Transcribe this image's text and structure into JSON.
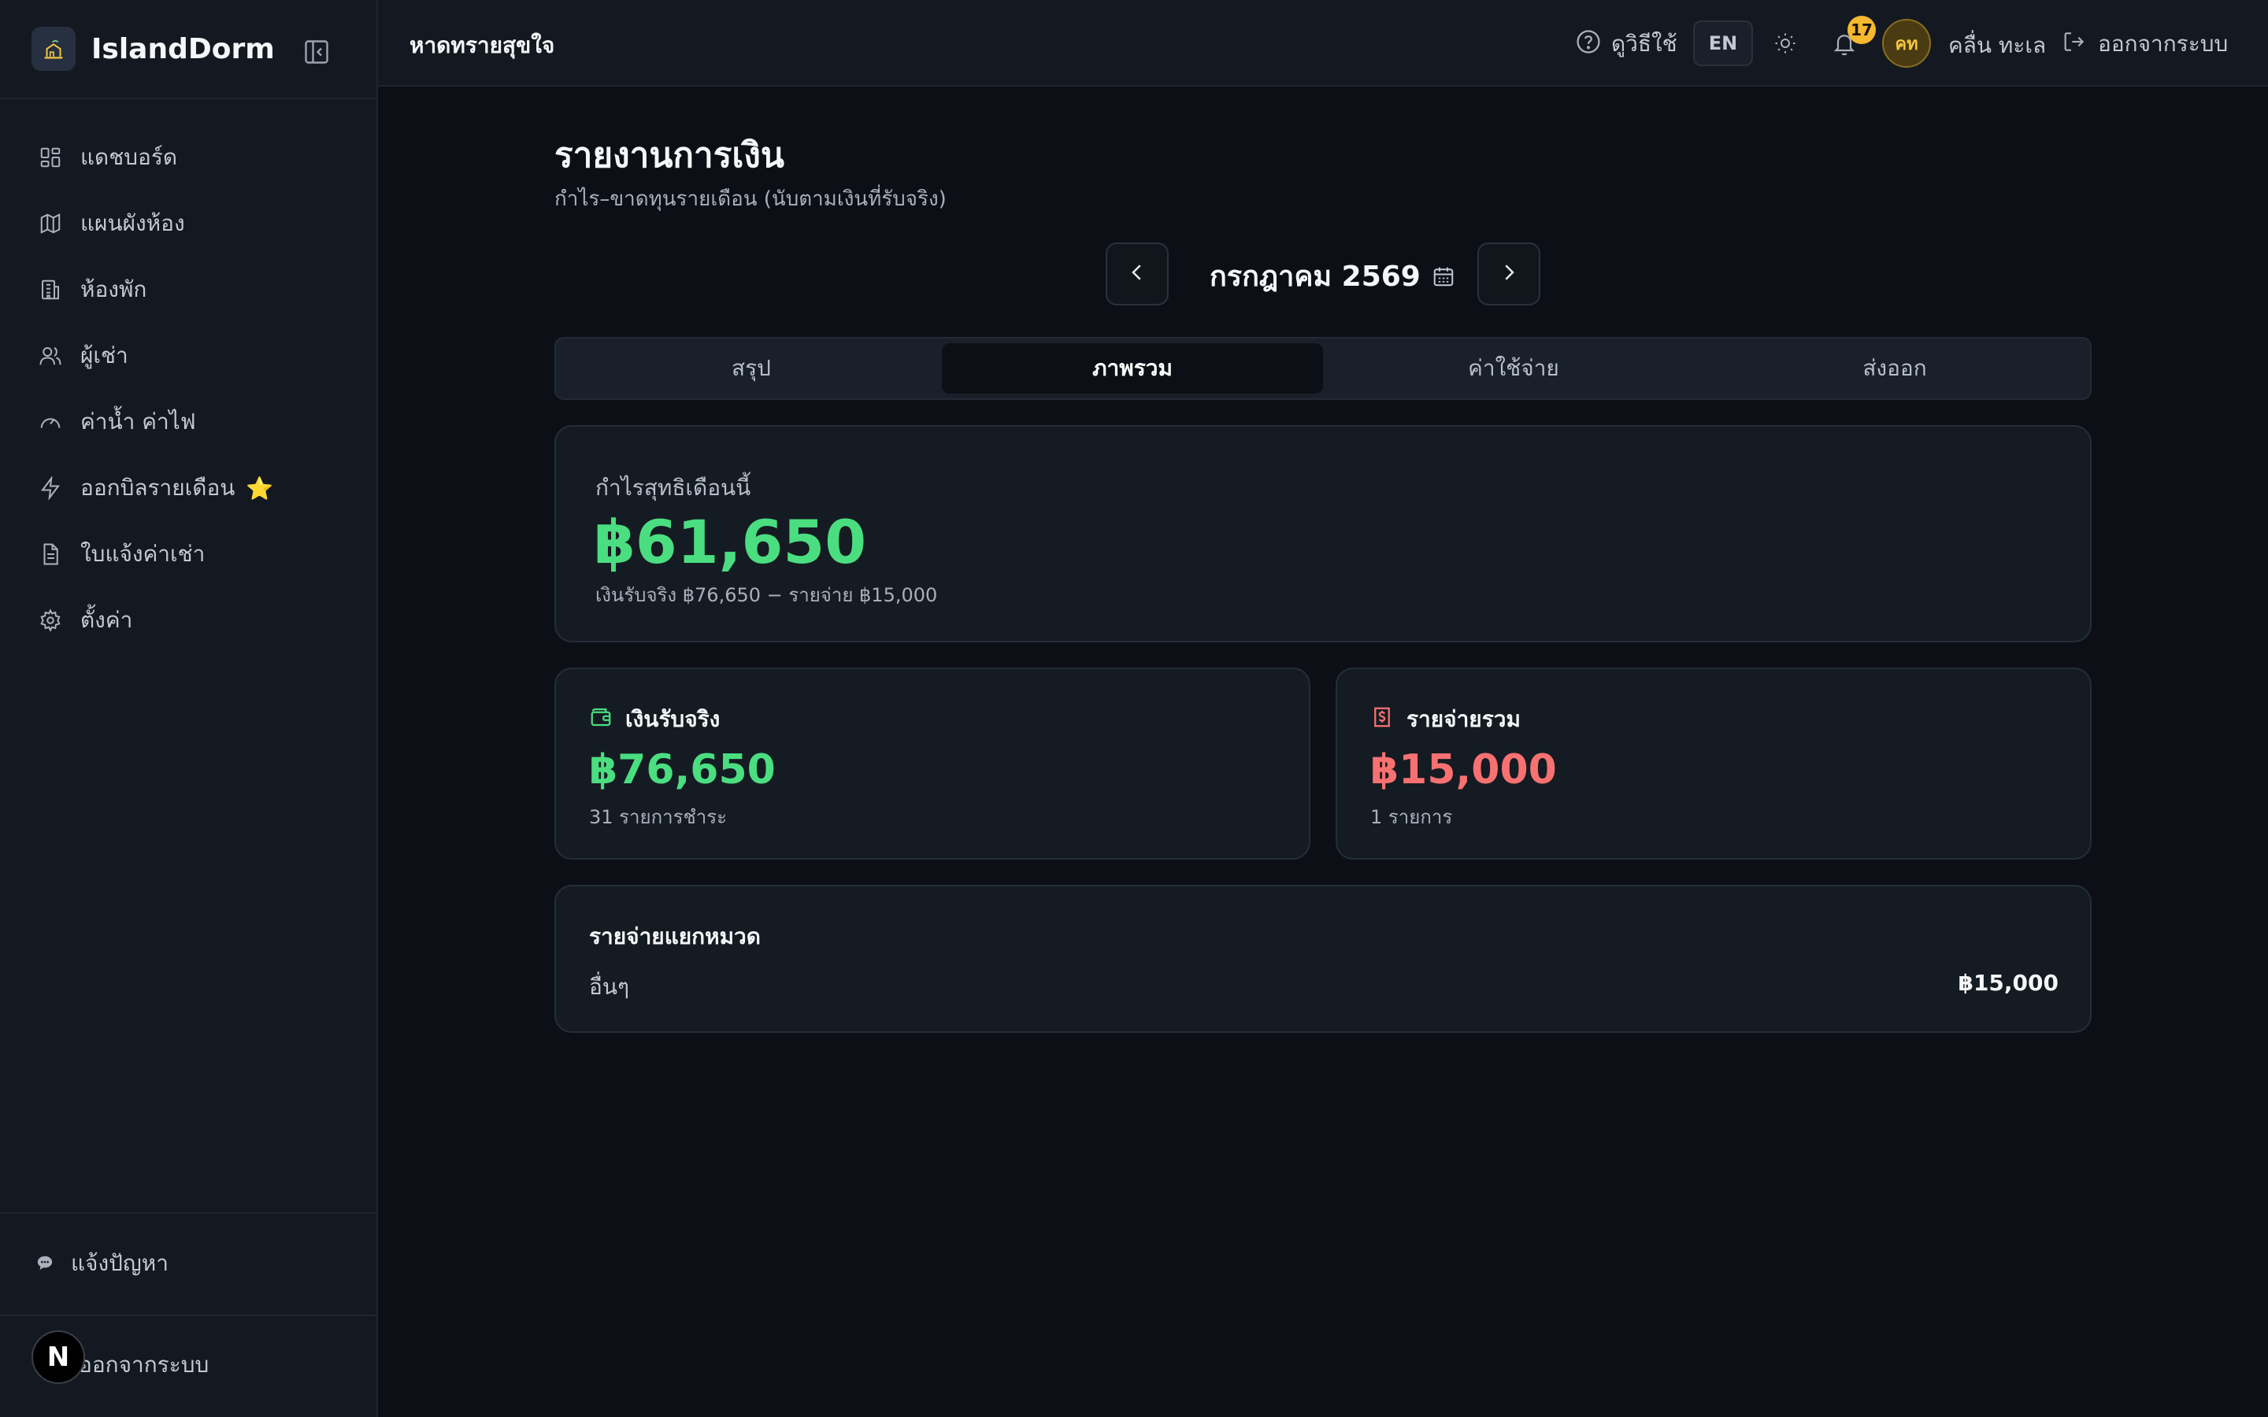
{
  "app": {
    "name": "IslandDorm"
  },
  "sidebar": {
    "items": [
      {
        "label": "แดชบอร์ด",
        "icon": "dashboard-icon"
      },
      {
        "label": "แผนผังห้อง",
        "icon": "map-icon"
      },
      {
        "label": "ห้องพัก",
        "icon": "building-icon"
      },
      {
        "label": "ผู้เช่า",
        "icon": "users-icon"
      },
      {
        "label": "ค่าน้ำ ค่าไฟ",
        "icon": "gauge-icon"
      },
      {
        "label": "ออกบิลรายเดือน",
        "icon": "lightning-icon",
        "badge": "⭐"
      },
      {
        "label": "ใบแจ้งค่าเช่า",
        "icon": "document-icon"
      },
      {
        "label": "ตั้งค่า",
        "icon": "gear-icon"
      }
    ],
    "report_issue": "แจ้งปัญหา",
    "logout": "ออกจากระบบ",
    "dev_badge": "N"
  },
  "topbar": {
    "dorm_name": "หาดทรายสุขใจ",
    "help": "ดูวิธีใช้",
    "lang": "EN",
    "notifications_count": "17",
    "avatar_initials": "คท",
    "user_name": "คลื่น ทะเล",
    "logout": "ออกจากระบบ"
  },
  "page": {
    "title": "รายงานการเงิน",
    "subtitle": "กำไร–ขาดทุนรายเดือน (นับตามเงินที่รับจริง)",
    "month": "กรกฎาคม 2569"
  },
  "tabs": [
    {
      "label": "สรุป",
      "active": false
    },
    {
      "label": "ภาพรวม",
      "active": true
    },
    {
      "label": "ค่าใช้จ่าย",
      "active": false
    },
    {
      "label": "ส่งออก",
      "active": false
    }
  ],
  "profit": {
    "label": "กำไรสุทธิเดือนนี้",
    "value": "฿61,650",
    "formula": "เงินรับจริง ฿76,650 − รายจ่าย ฿15,000"
  },
  "income": {
    "label": "เงินรับจริง",
    "value": "฿76,650",
    "sub": "31 รายการชำระ",
    "color": "#4ade80"
  },
  "expense": {
    "label": "รายจ่ายรวม",
    "value": "฿15,000",
    "sub": "1 รายการ",
    "color": "#f87171"
  },
  "categories": {
    "title": "รายจ่ายแยกหมวด",
    "rows": [
      {
        "name": "อื่นๆ",
        "amount": "฿15,000"
      }
    ]
  }
}
